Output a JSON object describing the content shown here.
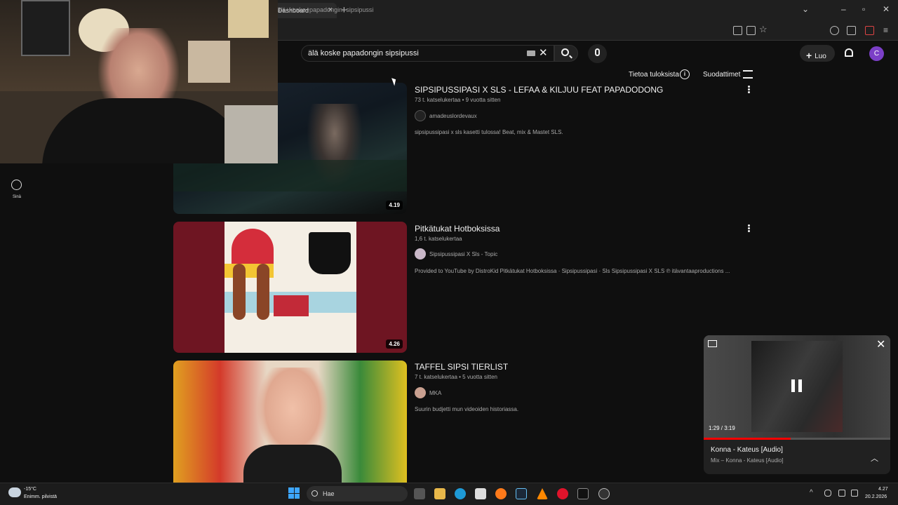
{
  "browser": {
    "tab_title": "Dashboard",
    "url": "älä+koske+papadongin+sipsipussi"
  },
  "header": {
    "search_query": "älä koske papadongin sipsipussi",
    "create_label": "Luo",
    "avatar_letter": "C",
    "about_results": "Tietoa tuloksista",
    "filters": "Suodattimet"
  },
  "sidebar": {
    "you_label": "Sinä"
  },
  "results": [
    {
      "title": "SIPSIPUSSIPASI X SLS - LEFAA & KILJUU FEAT PAPADODONG",
      "meta": "73 t. katselukertaa • 9 vuotta sitten",
      "channel": "amadeuslordevaux",
      "description": "sipsipussipasi x sls kasetti tulossa! Beat, mix & Mastet SLS.",
      "duration": "4.19"
    },
    {
      "title": "Pitkätukat Hotboksissa",
      "meta": "1,6 t. katselukertaa",
      "channel": "Sipsipussipasi X Sls - Topic",
      "description": "Provided to YouTube by DistroKid Pitkätukat Hotboksissa · Sipsipussipasi · Sls Sipsipussipasi X SLS ℗ itävantaaproductions ...",
      "duration": "4.26"
    },
    {
      "title": "TAFFEL SIPSI TIERLIST",
      "meta": "7 t. katselukertaa • 5 vuotta sitten",
      "channel": "MKA",
      "description": "Suurin budjetti mun videoiden historiassa.",
      "duration": ""
    }
  ],
  "miniplayer": {
    "time": "1:29 / 3:19",
    "progress": 0.466,
    "title": "Konna - Kateus [Audio]",
    "subtitle": "Mix – Konna - Kateus [Audio]"
  },
  "taskbar": {
    "temperature": "-15°C",
    "weather": "Enimm. pilvistä",
    "search_placeholder": "Hae",
    "time": "4.27",
    "date": "20.2.2026"
  },
  "colors": {
    "background": "#0f0f0f",
    "accent_red": "#ff0000",
    "avatar": "#7b3fc7"
  }
}
